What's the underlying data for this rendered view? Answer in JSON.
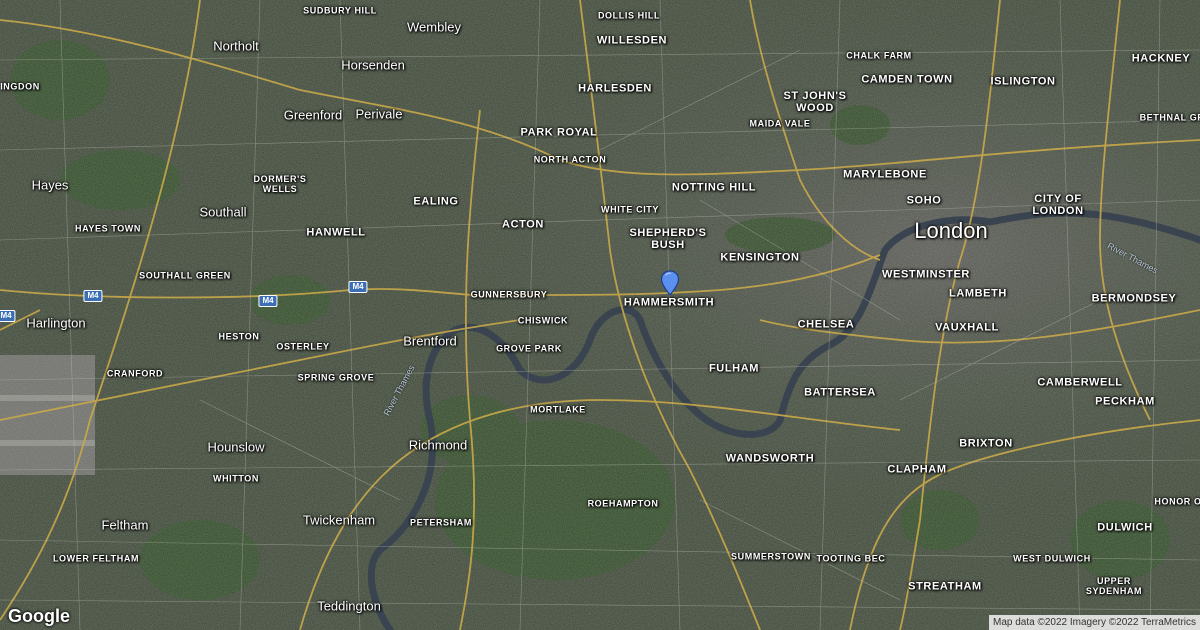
{
  "map": {
    "logo": "Google",
    "attribution": "Map data ©2022 Imagery ©2022 TerraMetrics",
    "river": "River Thames",
    "pin_label": "location-pin",
    "places": {
      "sudbury_hill": "SUDBURY HILL",
      "wembley": "Wembley",
      "dollis_hill": "DOLLIS HILL",
      "willesden": "WILLESDEN",
      "northolt": "Northolt",
      "horsenden": "Horsenden",
      "ingdon": "INGDON",
      "harlesden": "HARLESDEN",
      "chalk_farm": "CHALK FARM",
      "camden_town": "CAMDEN TOWN",
      "islington": "ISLINGTON",
      "hackney": "HACKNEY",
      "greenford": "Greenford",
      "perivale": "Perivale",
      "st_johns_wood": "ST JOHN'S\nWOOD",
      "maida_vale": "MAIDA VALE",
      "bethnal_green": "BETHNAL GR",
      "park_royal": "PARK ROYAL",
      "north_acton": "NORTH ACTON",
      "marylebone": "MARYLEBONE",
      "hayes": "Hayes",
      "dormers_wells": "DORMER'S\nWELLS",
      "notting_hill": "NOTTING HILL",
      "soho": "SOHO",
      "city_of_london": "CITY OF\nLONDON",
      "southall": "Southall",
      "ealing": "EALING",
      "white_city": "WHITE CITY",
      "london": "London",
      "hayes_town": "HAYES TOWN",
      "hanwell": "HANWELL",
      "acton": "ACTON",
      "shepherds_bush": "SHEPHERD'S\nBUSH",
      "kensington": "KENSINGTON",
      "southall_green": "SOUTHALL GREEN",
      "westminster": "WESTMINSTER",
      "gunnersbury": "GUNNERSBURY",
      "hammersmith": "HAMMERSMITH",
      "lambeth": "LAMBETH",
      "bermondsey": "BERMONDSEY",
      "harlington": "Harlington",
      "chiswick": "CHISWICK",
      "chelsea": "CHELSEA",
      "vauxhall": "VAUXHALL",
      "heston": "HESTON",
      "brentford": "Brentford",
      "osterley": "OSTERLEY",
      "grove_park": "GROVE PARK",
      "fulham": "FULHAM",
      "cranford": "CRANFORD",
      "spring_grove": "SPRING GROVE",
      "camberwell": "CAMBERWELL",
      "battersea": "BATTERSEA",
      "mortlake": "MORTLAKE",
      "peckham": "PECKHAM",
      "hounslow": "Hounslow",
      "richmond": "Richmond",
      "brixton": "BRIXTON",
      "wandsworth": "WANDSWORTH",
      "clapham": "CLAPHAM",
      "whitton": "WHITTON",
      "honor_oak": "HONOR O",
      "roehampton": "ROEHAMPTON",
      "feltham": "Feltham",
      "twickenham": "Twickenham",
      "petersham": "PETERSHAM",
      "dulwich": "DULWICH",
      "summerstown": "SUMMERSTOWN",
      "tooting_bec": "TOOTING BEC",
      "lower_feltham": "LOWER FELTHAM",
      "west_dulwich": "WEST DULWICH",
      "streatham": "STREATHAM",
      "upper_sydenham": "UPPER\nSYDENHAM",
      "teddington": "Teddington"
    },
    "road_shields": [
      "M4",
      "M4",
      "M4",
      "M4"
    ]
  }
}
